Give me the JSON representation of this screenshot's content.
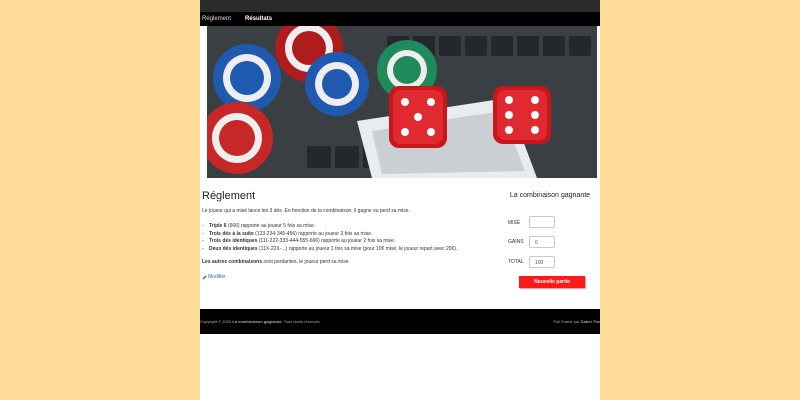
{
  "nav": {
    "items": [
      {
        "label": "Réglement"
      },
      {
        "label": "Résultats"
      }
    ]
  },
  "hero": {
    "image": "casino-chips-and-red-dice-over-keyboard"
  },
  "rules": {
    "title": "Réglement",
    "intro": "Le joueur qui a misé lance les 3 dés. En fonction de la combinaison, il gagne ou perd sa mise.",
    "items": [
      {
        "bold": "Triple 6",
        "text": " (666) rapporte au joueur 5 fois sa mise."
      },
      {
        "bold": "Trois dés à la suite",
        "text": " (123-234-345-456) rapporte au joueur 3 fois sa mise."
      },
      {
        "bold": "Trois dés identiques",
        "text": " (111-222-333-444-555-666) rapporte au joueur 2 fois sa mise."
      },
      {
        "bold": "Deux dés identiques",
        "text": " (11X-22X-...) rapporte au joueur 1 fois sa mise (pour 10€ misé, le joueur repart avec 20€)."
      }
    ],
    "others_bold": "Les autres combinaisons",
    "others_text": " sont perdantes, le joueur perd sa mise",
    "modify_label": "Modifier"
  },
  "game": {
    "title": "La combinaison gagnante",
    "mise_label": "MISE",
    "mise_value": "",
    "gains_label": "GAINS",
    "gains_value": "0",
    "total_label": "TOTAL",
    "total_value": "100",
    "new_game_label": "Nouvelle partie"
  },
  "footer": {
    "copyright_prefix": "Copyright © 2020 ",
    "copyright_site": "La combinaison gagnante",
    "copyright_suffix": ". Tous droits réservés",
    "theme_prefix": "Full Frame par ",
    "theme_author": "Catch The"
  },
  "colors": {
    "background": "#ffdd99",
    "accent_button": "#ff1a1a",
    "footer": "#000000"
  }
}
